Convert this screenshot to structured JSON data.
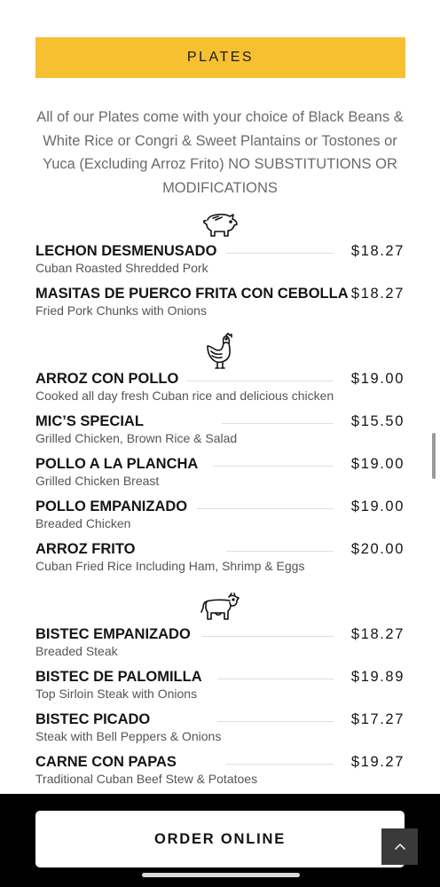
{
  "section": {
    "title": "PLATES",
    "banner_color": "#f6c030"
  },
  "intro": "All of our Plates come with your choice of Black Beans & White Rice or Congri & Sweet Plantains or Tostones or Yuca (Excluding Arroz Frito) NO SUBSTITUTIONS OR MODIFICATIONS",
  "categories": [
    {
      "icon": "pig-icon",
      "items": [
        {
          "name": "LECHON DESMENUSADO",
          "price": "$18.27",
          "description": "Cuban Roasted Shredded Pork"
        },
        {
          "name": "MASITAS DE PUERCO FRITA CON CEBOLLA",
          "price": "$18.27",
          "description": "Fried Pork Chunks with Onions"
        }
      ]
    },
    {
      "icon": "chicken-icon",
      "items": [
        {
          "name": "ARROZ CON POLLO",
          "price": "$19.00",
          "description": "Cooked all day fresh Cuban rice and delicious chicken"
        },
        {
          "name": "MIC’S SPECIAL",
          "price": "$15.50",
          "description": "Grilled Chicken, Brown Rice & Salad"
        },
        {
          "name": "POLLO A LA PLANCHA",
          "price": "$19.00",
          "description": "Grilled Chicken Breast"
        },
        {
          "name": "POLLO EMPANIZADO",
          "price": "$19.00",
          "description": "Breaded Chicken"
        },
        {
          "name": "ARROZ FRITO",
          "price": "$20.00",
          "description": "Cuban Fried Rice Including Ham, Shrimp & Eggs"
        }
      ]
    },
    {
      "icon": "cow-icon",
      "items": [
        {
          "name": "BISTEC EMPANIZADO",
          "price": "$18.27",
          "description": "Breaded Steak"
        },
        {
          "name": "BISTEC DE PALOMILLA",
          "price": "$19.89",
          "description": "Top Sirloin Steak with Onions"
        },
        {
          "name": "BISTEC PICADO",
          "price": "$17.27",
          "description": "Steak with Bell Peppers & Onions"
        },
        {
          "name": "CARNE CON PAPAS",
          "price": "$19.27",
          "description": "Traditional Cuban Beef Stew & Potatoes"
        }
      ]
    }
  ],
  "order_button": {
    "label": "ORDER ONLINE"
  },
  "scroll_top": {
    "icon": "chevron-up-icon"
  }
}
